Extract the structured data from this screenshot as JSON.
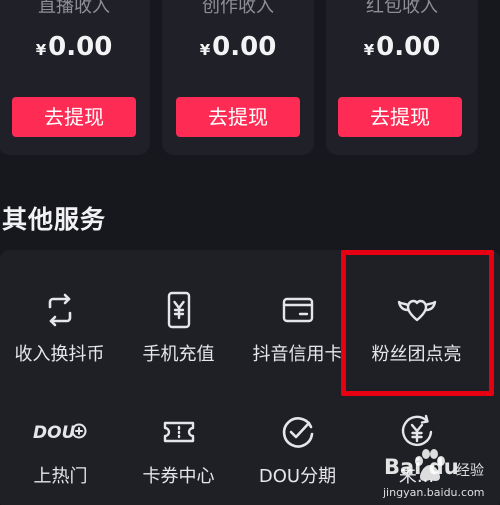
{
  "earnings": {
    "cards": [
      {
        "title": "直播收入",
        "currency": "¥",
        "amount": "0.00",
        "button": "去提现"
      },
      {
        "title": "创作收入",
        "currency": "¥",
        "amount": "0.00",
        "button": "去提现"
      },
      {
        "title": "红包收入",
        "currency": "¥",
        "amount": "0.00",
        "button": "去提现"
      }
    ]
  },
  "other_services": {
    "title": "其他服务",
    "items": [
      {
        "label": "收入换抖币",
        "icon": "exchange-icon"
      },
      {
        "label": "手机充值",
        "icon": "phone-recharge-icon"
      },
      {
        "label": "抖音信用卡",
        "icon": "credit-card-icon"
      },
      {
        "label": "粉丝团点亮",
        "icon": "winged-heart-icon"
      },
      {
        "label": "上热门",
        "icon": "dou-plus-icon",
        "icon_text": "DOU"
      },
      {
        "label": "卡券中心",
        "icon": "ticket-icon"
      },
      {
        "label": "DOU分期",
        "icon": "installment-check-icon"
      },
      {
        "label": "未...",
        "icon": "yen-refresh-icon"
      }
    ]
  },
  "highlight_color": "#e60012",
  "accent_color": "#fe2c55",
  "watermark": {
    "brand": "Bai du",
    "suffix": "经验",
    "url": "jingyan.baidu.com"
  }
}
